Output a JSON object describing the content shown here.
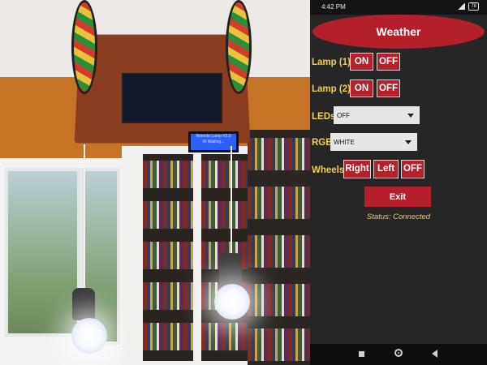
{
  "statusbar": {
    "time": "4:42 PM",
    "battery": "78"
  },
  "title_button": "Weather",
  "lamp1": {
    "label": "Lamp (1)",
    "on": "ON",
    "off": "OFF"
  },
  "lamp2": {
    "label": "Lamp (2)",
    "on": "ON",
    "off": "OFF"
  },
  "leds": {
    "label": "LEDs",
    "selected": "OFF"
  },
  "rgb": {
    "label": "RGB",
    "selected": "WHITE"
  },
  "wheels": {
    "label": "Wheels",
    "right": "Right",
    "left": "Left",
    "off": "OFF"
  },
  "exit_label": "Exit",
  "status_text": "Status: Connected",
  "photo": {
    "lcd_line1": "Remote Lamp V2.0",
    "lcd_line2": "W Waiting..."
  },
  "colors": {
    "accent_red": "#b5202a",
    "label_yellow": "#f2cf4e",
    "background": "#262626"
  },
  "icons": [
    "signal-icon",
    "battery-icon",
    "recent-apps-icon",
    "home-icon",
    "back-icon"
  ]
}
